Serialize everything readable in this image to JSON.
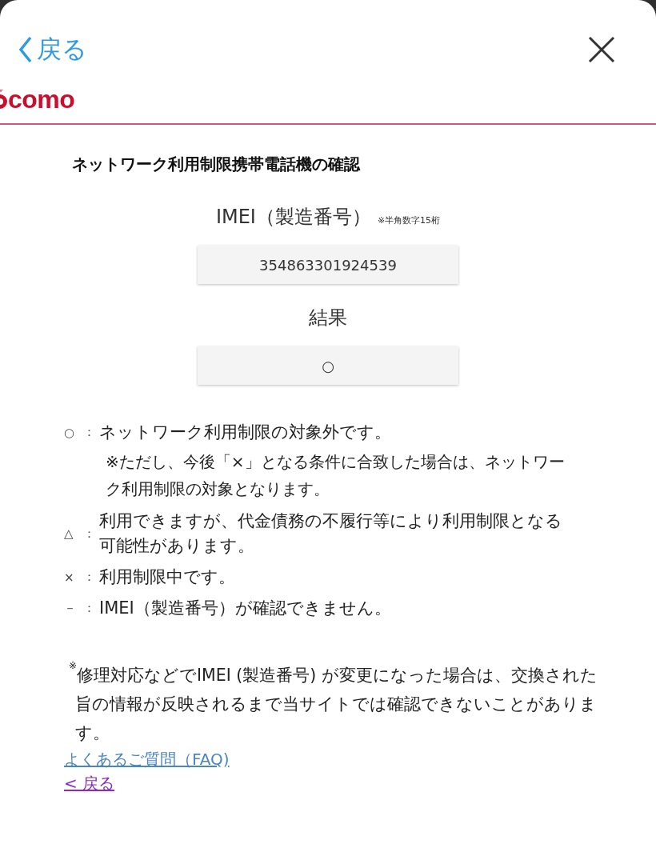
{
  "header": {
    "back": "戻る",
    "logo": "como"
  },
  "title": "ネットワーク利用制限携帯電話機の確認",
  "fields": [
    {
      "label": "IMEI（製造番号）",
      "note": "※半角数字15桁",
      "value": "354863301924539"
    },
    {
      "label": "結果",
      "value": "○"
    }
  ],
  "legend": [
    {
      "symbol": "○",
      "colon": "：",
      "lines": [
        "ネットワーク利用制限の対象外です。"
      ],
      "note": "※ただし、今後「×」となる条件に合致した場合は、ネットワーク利用制限の対象となります。"
    },
    {
      "symbol": "△",
      "colon": "：",
      "lines": [
        "利用できますが、代金債務の不履行等により利用制限となる",
        "可能性があります。"
      ]
    },
    {
      "symbol": "×",
      "colon": "：",
      "lines": [
        "利用制限中です。"
      ]
    },
    {
      "symbol": "－",
      "colon": "：",
      "lines": [
        "IMEI（製造番号）が確認できません。"
      ]
    }
  ],
  "footnote": "$^{※}$修理対応などでIMEI (製造番号) が変更になった場合は、交換された旨の情報が反映されるまで当サイトでは確認できないことがあります。",
  "links": [
    {
      "label": "よくあるご質問（FAQ)",
      "visited": false
    },
    {
      "label": "< 戻る",
      "visited": true
    }
  ]
}
